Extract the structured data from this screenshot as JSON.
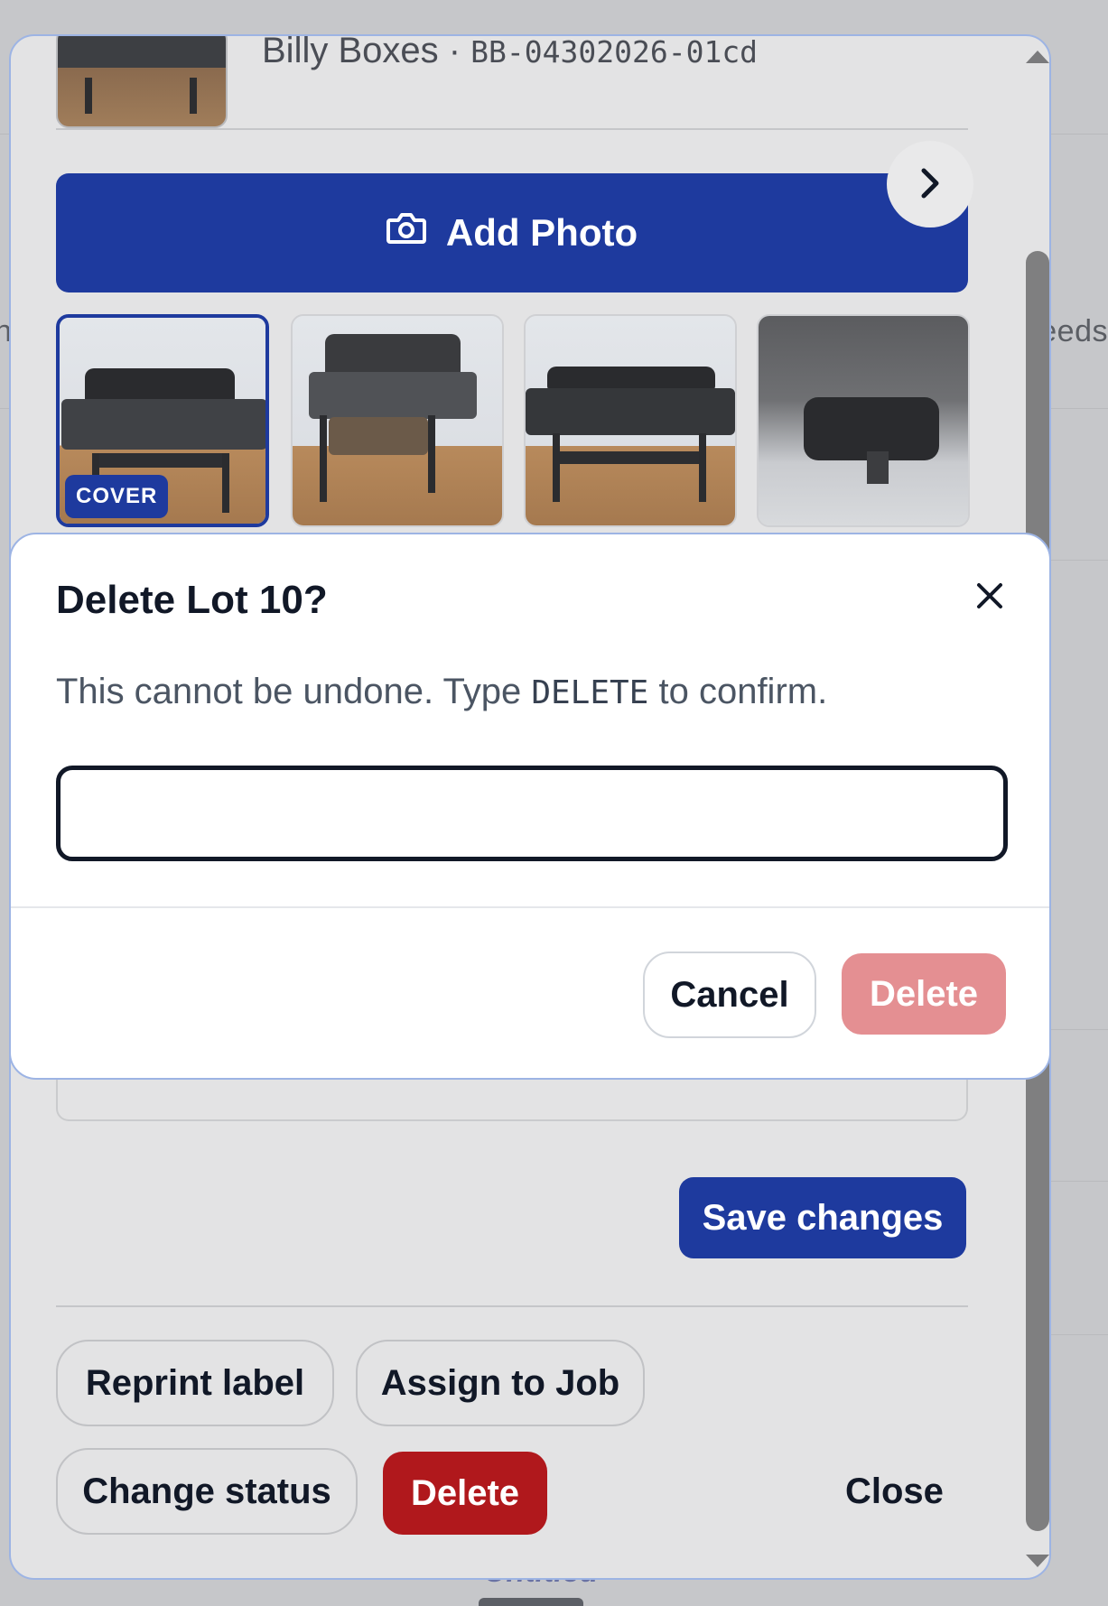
{
  "background": {
    "edge_text_right": "eeds",
    "edge_text_left": "n",
    "bottom_text": "Untitled"
  },
  "lot": {
    "seller": "Billy Boxes",
    "separator": " · ",
    "code": "BB-04302026-01cd"
  },
  "photos": {
    "add_label": "Add Photo",
    "cover_label": "COVER",
    "count_visible": 4
  },
  "editor": {
    "save_label": "Save changes",
    "reprint_label": "Reprint label",
    "assign_label": "Assign to Job",
    "change_status_label": "Change status",
    "delete_label": "Delete",
    "close_label": "Close"
  },
  "dialog": {
    "title": "Delete Lot 10?",
    "message_before": "This cannot be undone. Type ",
    "keyword": "DELETE",
    "message_after": " to confirm.",
    "input_value": "",
    "cancel_label": "Cancel",
    "delete_label": "Delete"
  },
  "icons": {
    "add_photo": "camera-icon",
    "next": "chevron-right-icon",
    "close": "close-icon"
  },
  "colors": {
    "primary": "#1e3a9e",
    "danger": "#b0181c",
    "danger_disabled": "#e48f92",
    "modal_border": "#9db4e4"
  }
}
